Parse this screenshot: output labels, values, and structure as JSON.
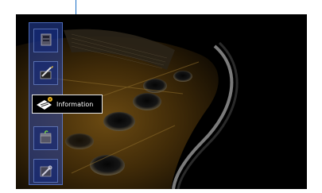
{
  "menu": {
    "selected_label": "Information",
    "items": [
      {
        "icon": "input-select-icon"
      },
      {
        "icon": "edit-pencil-icon"
      },
      {
        "icon": "information-icon"
      },
      {
        "icon": "box-icon"
      },
      {
        "icon": "tools-icon"
      }
    ]
  },
  "colors": {
    "callout": "#1b6fc7",
    "menu_bar": "#2846aa",
    "highlight_border": "#e8e8e8"
  }
}
